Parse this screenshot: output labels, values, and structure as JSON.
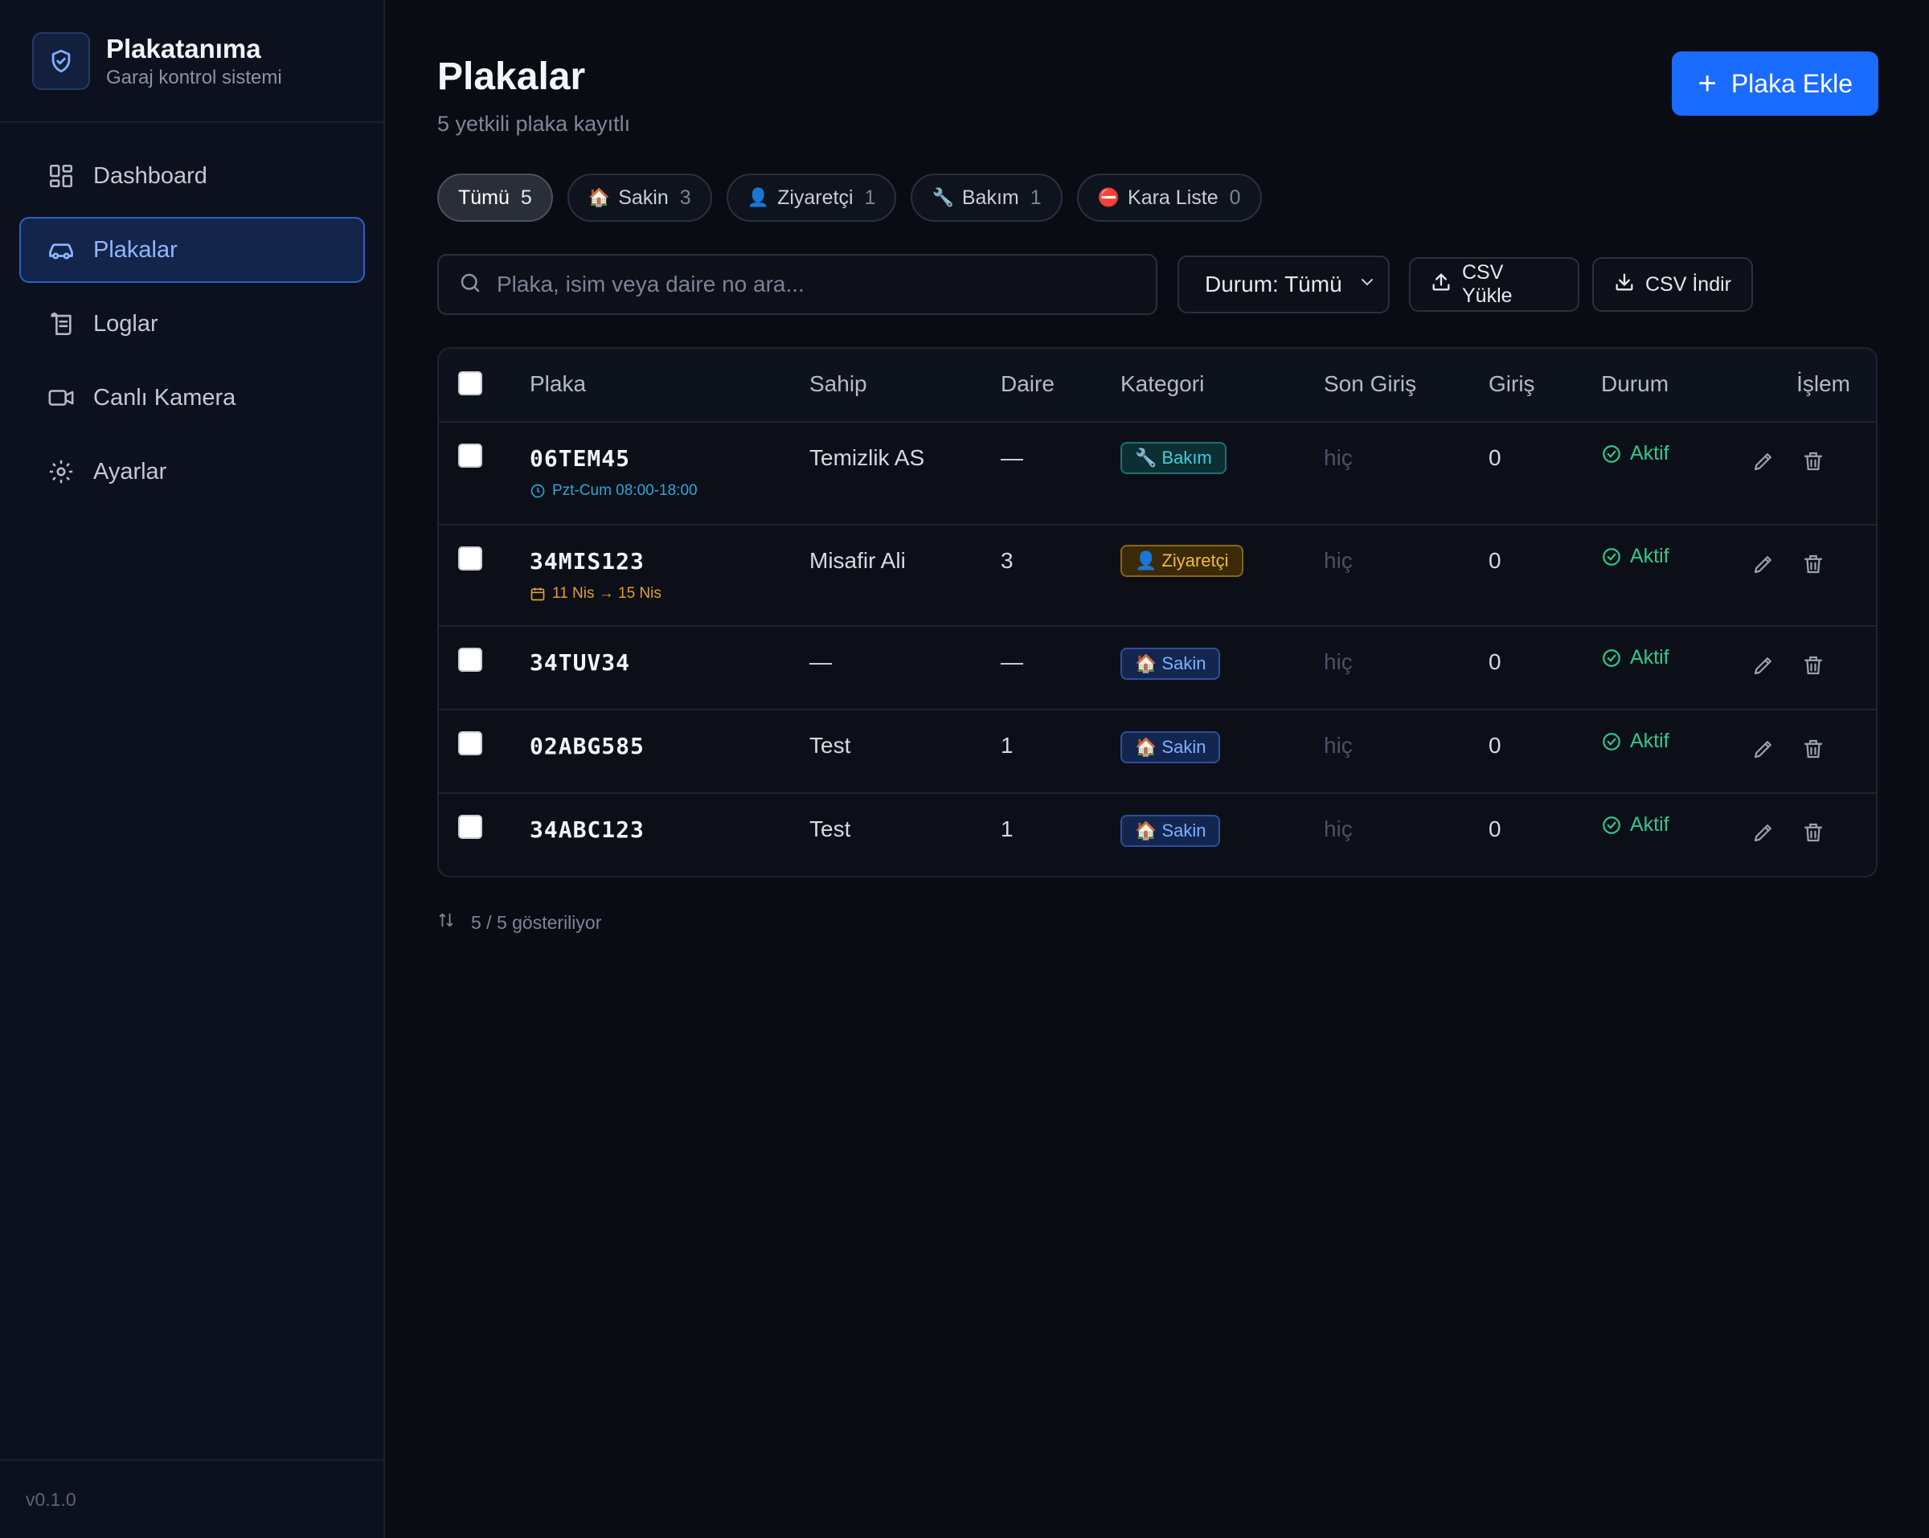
{
  "app": {
    "name": "Plakatanıma",
    "subtitle": "Garaj kontrol sistemi",
    "version": "v0.1.0"
  },
  "nav": {
    "items": [
      {
        "label": "Dashboard",
        "icon": "grid-icon"
      },
      {
        "label": "Plakalar",
        "icon": "car-icon",
        "active": true
      },
      {
        "label": "Loglar",
        "icon": "scroll-icon"
      },
      {
        "label": "Canlı Kamera",
        "icon": "video-icon"
      },
      {
        "label": "Ayarlar",
        "icon": "gear-icon"
      }
    ]
  },
  "header": {
    "title": "Plakalar",
    "subtitle": "5 yetkili plaka kayıtlı",
    "add_button": "Plaka Ekle"
  },
  "filters": [
    {
      "label": "Tümü",
      "count": "5",
      "emoji": "",
      "active": true
    },
    {
      "label": "Sakin",
      "count": "3",
      "emoji": "🏠"
    },
    {
      "label": "Ziyaretçi",
      "count": "1",
      "emoji": "👤"
    },
    {
      "label": "Bakım",
      "count": "1",
      "emoji": "🔧"
    },
    {
      "label": "Kara Liste",
      "count": "0",
      "emoji": "⛔"
    }
  ],
  "toolbar": {
    "search_placeholder": "Plaka, isim veya daire no ara...",
    "status_select": "Durum: Tümü",
    "csv_upload": "CSV Yükle",
    "csv_download": "CSV İndir"
  },
  "table": {
    "columns": [
      "Plaka",
      "Sahip",
      "Daire",
      "Kategori",
      "Son Giriş",
      "Giriş",
      "Durum",
      "İşlem"
    ],
    "rows": [
      {
        "plate": "06TEM45",
        "note": "Pzt-Cum 08:00-18:00",
        "note_type": "schedule",
        "owner": "Temizlik AS",
        "unit": "—",
        "category": "Bakım",
        "category_emoji": "🔧",
        "category_type": "bakim",
        "last_entry": "hiç",
        "entries": "0",
        "status": "Aktif"
      },
      {
        "plate": "34MIS123",
        "note": "11 Nis → 15 Nis",
        "note_type": "date",
        "owner": "Misafir Ali",
        "unit": "3",
        "category": "Ziyaretçi",
        "category_emoji": "👤",
        "category_type": "ziyaretci",
        "last_entry": "hiç",
        "entries": "0",
        "status": "Aktif"
      },
      {
        "plate": "34TUV34",
        "note": "",
        "owner": "—",
        "unit": "—",
        "category": "Sakin",
        "category_emoji": "🏠",
        "category_type": "sakin",
        "last_entry": "hiç",
        "entries": "0",
        "status": "Aktif"
      },
      {
        "plate": "02ABG585",
        "note": "",
        "owner": "Test",
        "unit": "1",
        "category": "Sakin",
        "category_emoji": "🏠",
        "category_type": "sakin",
        "last_entry": "hiç",
        "entries": "0",
        "status": "Aktif"
      },
      {
        "plate": "34ABC123",
        "note": "",
        "owner": "Test",
        "unit": "1",
        "category": "Sakin",
        "category_emoji": "🏠",
        "category_type": "sakin",
        "last_entry": "hiç",
        "entries": "0",
        "status": "Aktif"
      }
    ]
  },
  "footer": {
    "showing": "5 / 5 gösteriliyor"
  },
  "colors": {
    "accent": "#1a6bff",
    "success": "#2fc98a",
    "background": "#0a0c14"
  }
}
